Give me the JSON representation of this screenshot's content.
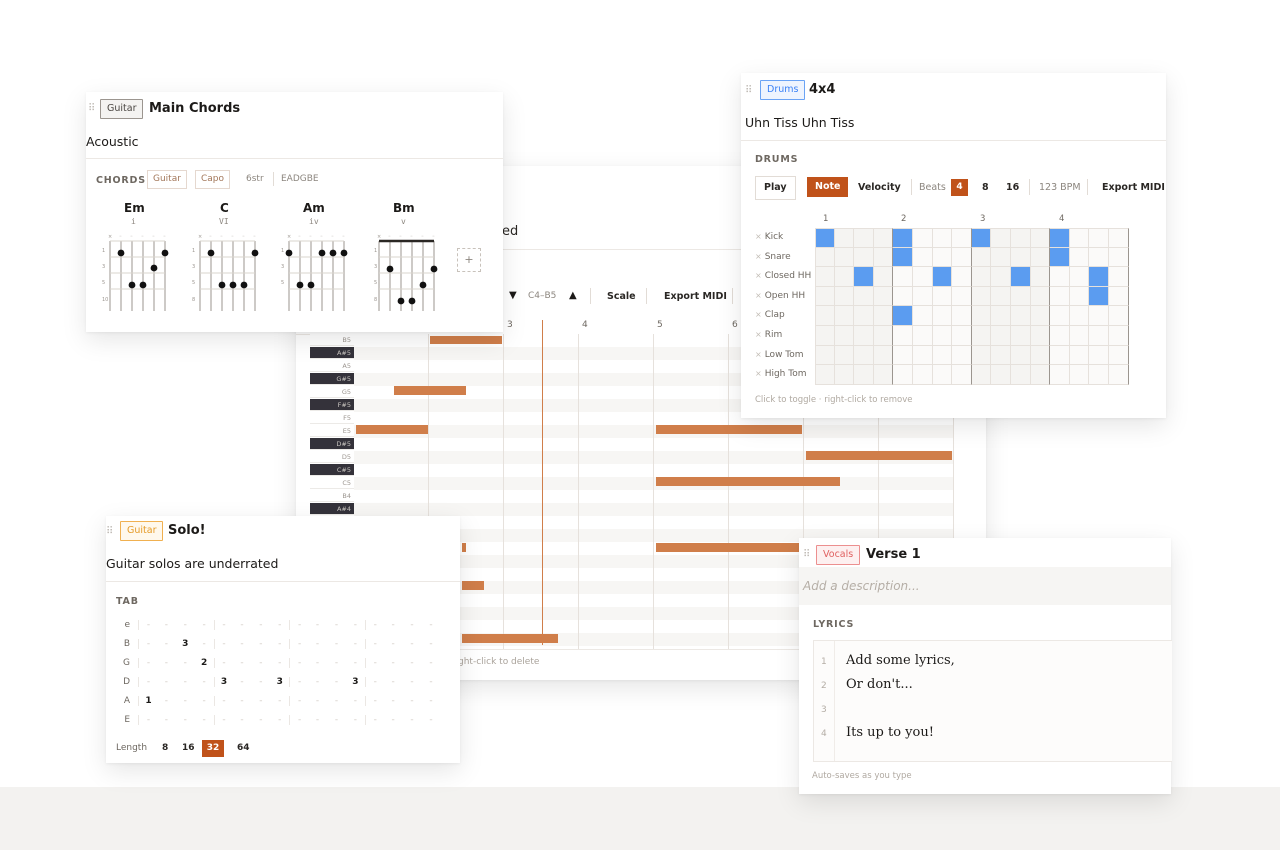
{
  "piano": {
    "title_fragment": "ed",
    "range": {
      "down_label": "▼",
      "range_label": "C4–B5",
      "up_label": "▲"
    },
    "scale_label": "Scale",
    "export_label": "Export MIDI",
    "bar_numbers": [
      "3",
      "4",
      "5",
      "6"
    ],
    "keys": [
      {
        "name": "B5",
        "black": false
      },
      {
        "name": "A#5",
        "black": true
      },
      {
        "name": "A5",
        "black": false
      },
      {
        "name": "G#5",
        "black": true
      },
      {
        "name": "G5",
        "black": false
      },
      {
        "name": "F#5",
        "black": true
      },
      {
        "name": "F5",
        "black": false
      },
      {
        "name": "E5",
        "black": false
      },
      {
        "name": "D#5",
        "black": true
      },
      {
        "name": "D5",
        "black": false
      },
      {
        "name": "C#5",
        "black": true
      },
      {
        "name": "C5",
        "black": false
      },
      {
        "name": "B4",
        "black": false
      },
      {
        "name": "A#4",
        "black": true
      }
    ],
    "hint_fragment": "ght-click to delete"
  },
  "chords": {
    "tag": "Guitar",
    "title": "Main Chords",
    "description": "Acoustic",
    "section_label": "CHORDS",
    "instrument_chip": "Guitar",
    "capo_chip": "Capo",
    "strings_label": "6str",
    "tuning_label": "EADGBE",
    "items": [
      {
        "name": "Em",
        "numeral": "i"
      },
      {
        "name": "C",
        "numeral": "VI"
      },
      {
        "name": "Am",
        "numeral": "iv"
      },
      {
        "name": "Bm",
        "numeral": "v"
      }
    ],
    "add_label": "+"
  },
  "drums": {
    "tag": "Drums",
    "title": "4x4",
    "description": "Uhn Tiss Uhn Tiss",
    "section_label": "DRUMS",
    "play_label": "Play",
    "note_label": "Note",
    "velocity_label": "Velocity",
    "beats_label": "Beats",
    "beat_options": [
      "4",
      "8",
      "16"
    ],
    "bpm_label": "123 BPM",
    "export_label": "Export MIDI",
    "beat_numbers": [
      "1",
      "2",
      "3",
      "4"
    ],
    "rows": [
      {
        "name": "Kick",
        "steps": [
          0,
          4,
          8,
          12
        ]
      },
      {
        "name": "Snare",
        "steps": [
          4,
          12
        ]
      },
      {
        "name": "Closed HH",
        "steps": [
          2,
          6,
          10,
          14
        ]
      },
      {
        "name": "Open HH",
        "steps": [
          14
        ]
      },
      {
        "name": "Clap",
        "steps": [
          4
        ]
      },
      {
        "name": "Rim",
        "steps": []
      },
      {
        "name": "Low Tom",
        "steps": []
      },
      {
        "name": "High Tom",
        "steps": []
      }
    ],
    "hint": "Click to toggle · right-click to remove"
  },
  "solo": {
    "tag": "Guitar",
    "title": "Solo!",
    "description": "Guitar solos are underrated",
    "section_label": "TAB",
    "strings": [
      "e",
      "B",
      "G",
      "D",
      "A",
      "E"
    ],
    "notes": [
      {
        "string": 1,
        "pos": 2,
        "fret": "3"
      },
      {
        "string": 2,
        "pos": 3,
        "fret": "2"
      },
      {
        "string": 3,
        "pos": 4,
        "fret": "3"
      },
      {
        "string": 3,
        "pos": 7,
        "fret": "3"
      },
      {
        "string": 3,
        "pos": 11,
        "fret": "3"
      },
      {
        "string": 4,
        "pos": 0,
        "fret": "1"
      }
    ],
    "length_label": "Length",
    "length_options": [
      "8",
      "16",
      "32",
      "64"
    ],
    "length_selected": "32"
  },
  "vocals": {
    "tag": "Vocals",
    "title": "Verse 1",
    "description_placeholder": "Add a description...",
    "section_label": "LYRICS",
    "lines": [
      {
        "num": "1",
        "text": "Add some lyrics,"
      },
      {
        "num": "2",
        "text": "Or don't..."
      },
      {
        "num": "3",
        "text": ""
      },
      {
        "num": "4",
        "text": "Its up to you!"
      }
    ],
    "footer": "Auto-saves as you type"
  },
  "colors": {
    "accent": "#c0521a",
    "note": "#d07e4a",
    "drum_on": "#5b9cf0",
    "guitar_tag": "#e59a27",
    "drums_tag": "#3b82f6",
    "vocals_tag": "#e06060"
  }
}
